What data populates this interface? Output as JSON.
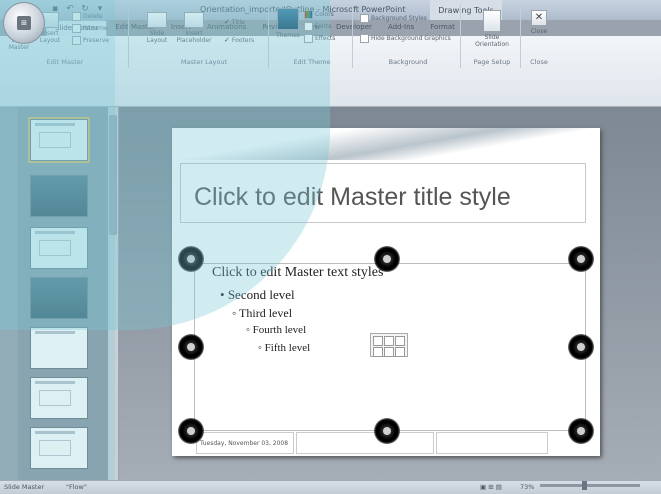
{
  "window": {
    "doc_title": "Orientation_importedOutline - Microsoft PowerPoint",
    "context_tab_group": "Drawing Tools"
  },
  "tabs": [
    {
      "label": "Slide Master"
    },
    {
      "label": "Edit Master"
    },
    {
      "label": "Insert"
    },
    {
      "label": "Animations"
    },
    {
      "label": "Review"
    },
    {
      "label": "View"
    },
    {
      "label": "Developer"
    },
    {
      "label": "Add-Ins"
    },
    {
      "label": "Format"
    }
  ],
  "ribbon": {
    "edit_master": {
      "label": "Edit Master",
      "insert_slide_master": "Insert Slide\nMaster",
      "insert_layout": "Insert\nLayout",
      "delete": "Delete",
      "rename": "Rename",
      "preserve": "Preserve"
    },
    "master_layout": {
      "label": "Master Layout",
      "slide_layout": "Slide\nLayout",
      "insert_placeholder": "Insert\nPlaceholder",
      "title": "Title",
      "footers": "Footers"
    },
    "edit_theme": {
      "label": "Edit Theme",
      "themes": "Themes",
      "colors": "Colors",
      "fonts": "Fonts",
      "effects": "Effects"
    },
    "background": {
      "label": "Background",
      "background_styles": "Background Styles",
      "hide_background_graphics": "Hide Background Graphics"
    },
    "page_setup": {
      "label": "Page Setup",
      "slide_orientation": "Slide\nOrientation"
    },
    "close": {
      "label": "Close",
      "close_btn": "Close"
    }
  },
  "slide": {
    "title": "Click to edit Master title style",
    "levels": [
      "Click to edit Master text styles",
      "Second level",
      "Third level",
      "Fourth level",
      "Fifth level"
    ],
    "date": "Tuesday, November 03, 2008"
  },
  "status": {
    "left": "Slide Master",
    "theme": "\"Flow\"",
    "zoom": "73%"
  }
}
